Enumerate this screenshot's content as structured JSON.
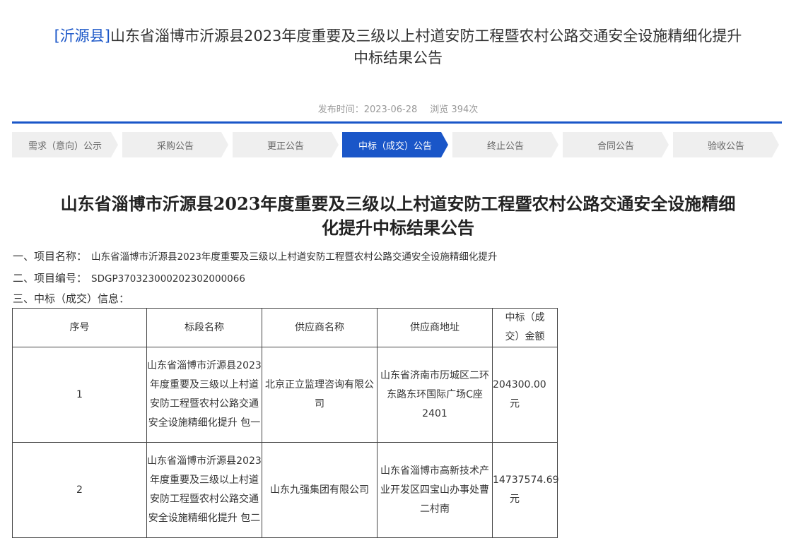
{
  "header": {
    "region": "[沂源县]",
    "title_line1": "山东省淄博市沂源县2023年度重要及三级以上村道安防工程暨农村公路交通安全设施精细化提升",
    "title_line2": "中标结果公告",
    "publish_time": "发布时间：2023-06-28",
    "views": "浏览 394次"
  },
  "steps": [
    "需求（意向）公示",
    "采购公告",
    "更正公告",
    "中标（成交）公告",
    "终止公告",
    "合同公告",
    "验收公告"
  ],
  "active_step": 3,
  "doc": {
    "title_line1": "山东省淄博市沂源县2023年度重要及三级以上村道安防工程暨农村公路交通安全设施精细",
    "title_line2": "化提升中标结果公告",
    "item1_label": "一、项目名称：",
    "item1_value": "山东省淄博市沂源县2023年度重要及三级以上村道安防工程暨农村公路交通安全设施精细化提升",
    "item2_label": "二、项目编号：",
    "item2_value": "SDGP370323000202302000066",
    "item3_label": "三、中标（成交）信息："
  },
  "table": {
    "headers": [
      "序号",
      "标段名称",
      "供应商名称",
      "供应商地址",
      "中标（成交）金额"
    ],
    "rows": [
      {
        "no": "1",
        "section": "山东省淄博市沂源县2023年度重要及三级以上村道安防工程暨农村公路交通安全设施精细化提升 包一",
        "supplier": "北京正立监理咨询有限公司",
        "address": "山东省济南市历城区二环东路东环国际广场C座2401",
        "amount": "204300.00",
        "unit": "元"
      },
      {
        "no": "2",
        "section": "山东省淄博市沂源县2023年度重要及三级以上村道安防工程暨农村公路交通安全设施精细化提升 包二",
        "supplier": "山东九强集团有限公司",
        "address": "山东省淄博市高新技术产业开发区四宝山办事处曹二村南",
        "amount": "14737574.69",
        "unit": "元"
      }
    ]
  }
}
